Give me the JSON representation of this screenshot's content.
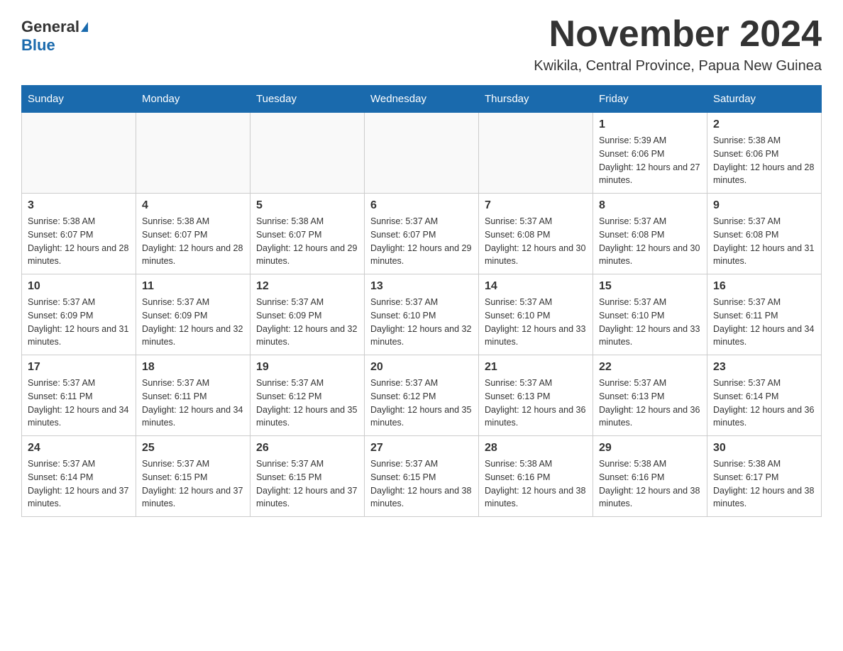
{
  "logo": {
    "general": "General",
    "blue": "Blue"
  },
  "header": {
    "month": "November 2024",
    "location": "Kwikila, Central Province, Papua New Guinea"
  },
  "days_of_week": [
    "Sunday",
    "Monday",
    "Tuesday",
    "Wednesday",
    "Thursday",
    "Friday",
    "Saturday"
  ],
  "weeks": [
    [
      {
        "day": "",
        "sunrise": "",
        "sunset": "",
        "daylight": ""
      },
      {
        "day": "",
        "sunrise": "",
        "sunset": "",
        "daylight": ""
      },
      {
        "day": "",
        "sunrise": "",
        "sunset": "",
        "daylight": ""
      },
      {
        "day": "",
        "sunrise": "",
        "sunset": "",
        "daylight": ""
      },
      {
        "day": "",
        "sunrise": "",
        "sunset": "",
        "daylight": ""
      },
      {
        "day": "1",
        "sunrise": "Sunrise: 5:39 AM",
        "sunset": "Sunset: 6:06 PM",
        "daylight": "Daylight: 12 hours and 27 minutes."
      },
      {
        "day": "2",
        "sunrise": "Sunrise: 5:38 AM",
        "sunset": "Sunset: 6:06 PM",
        "daylight": "Daylight: 12 hours and 28 minutes."
      }
    ],
    [
      {
        "day": "3",
        "sunrise": "Sunrise: 5:38 AM",
        "sunset": "Sunset: 6:07 PM",
        "daylight": "Daylight: 12 hours and 28 minutes."
      },
      {
        "day": "4",
        "sunrise": "Sunrise: 5:38 AM",
        "sunset": "Sunset: 6:07 PM",
        "daylight": "Daylight: 12 hours and 28 minutes."
      },
      {
        "day": "5",
        "sunrise": "Sunrise: 5:38 AM",
        "sunset": "Sunset: 6:07 PM",
        "daylight": "Daylight: 12 hours and 29 minutes."
      },
      {
        "day": "6",
        "sunrise": "Sunrise: 5:37 AM",
        "sunset": "Sunset: 6:07 PM",
        "daylight": "Daylight: 12 hours and 29 minutes."
      },
      {
        "day": "7",
        "sunrise": "Sunrise: 5:37 AM",
        "sunset": "Sunset: 6:08 PM",
        "daylight": "Daylight: 12 hours and 30 minutes."
      },
      {
        "day": "8",
        "sunrise": "Sunrise: 5:37 AM",
        "sunset": "Sunset: 6:08 PM",
        "daylight": "Daylight: 12 hours and 30 minutes."
      },
      {
        "day": "9",
        "sunrise": "Sunrise: 5:37 AM",
        "sunset": "Sunset: 6:08 PM",
        "daylight": "Daylight: 12 hours and 31 minutes."
      }
    ],
    [
      {
        "day": "10",
        "sunrise": "Sunrise: 5:37 AM",
        "sunset": "Sunset: 6:09 PM",
        "daylight": "Daylight: 12 hours and 31 minutes."
      },
      {
        "day": "11",
        "sunrise": "Sunrise: 5:37 AM",
        "sunset": "Sunset: 6:09 PM",
        "daylight": "Daylight: 12 hours and 32 minutes."
      },
      {
        "day": "12",
        "sunrise": "Sunrise: 5:37 AM",
        "sunset": "Sunset: 6:09 PM",
        "daylight": "Daylight: 12 hours and 32 minutes."
      },
      {
        "day": "13",
        "sunrise": "Sunrise: 5:37 AM",
        "sunset": "Sunset: 6:10 PM",
        "daylight": "Daylight: 12 hours and 32 minutes."
      },
      {
        "day": "14",
        "sunrise": "Sunrise: 5:37 AM",
        "sunset": "Sunset: 6:10 PM",
        "daylight": "Daylight: 12 hours and 33 minutes."
      },
      {
        "day": "15",
        "sunrise": "Sunrise: 5:37 AM",
        "sunset": "Sunset: 6:10 PM",
        "daylight": "Daylight: 12 hours and 33 minutes."
      },
      {
        "day": "16",
        "sunrise": "Sunrise: 5:37 AM",
        "sunset": "Sunset: 6:11 PM",
        "daylight": "Daylight: 12 hours and 34 minutes."
      }
    ],
    [
      {
        "day": "17",
        "sunrise": "Sunrise: 5:37 AM",
        "sunset": "Sunset: 6:11 PM",
        "daylight": "Daylight: 12 hours and 34 minutes."
      },
      {
        "day": "18",
        "sunrise": "Sunrise: 5:37 AM",
        "sunset": "Sunset: 6:11 PM",
        "daylight": "Daylight: 12 hours and 34 minutes."
      },
      {
        "day": "19",
        "sunrise": "Sunrise: 5:37 AM",
        "sunset": "Sunset: 6:12 PM",
        "daylight": "Daylight: 12 hours and 35 minutes."
      },
      {
        "day": "20",
        "sunrise": "Sunrise: 5:37 AM",
        "sunset": "Sunset: 6:12 PM",
        "daylight": "Daylight: 12 hours and 35 minutes."
      },
      {
        "day": "21",
        "sunrise": "Sunrise: 5:37 AM",
        "sunset": "Sunset: 6:13 PM",
        "daylight": "Daylight: 12 hours and 36 minutes."
      },
      {
        "day": "22",
        "sunrise": "Sunrise: 5:37 AM",
        "sunset": "Sunset: 6:13 PM",
        "daylight": "Daylight: 12 hours and 36 minutes."
      },
      {
        "day": "23",
        "sunrise": "Sunrise: 5:37 AM",
        "sunset": "Sunset: 6:14 PM",
        "daylight": "Daylight: 12 hours and 36 minutes."
      }
    ],
    [
      {
        "day": "24",
        "sunrise": "Sunrise: 5:37 AM",
        "sunset": "Sunset: 6:14 PM",
        "daylight": "Daylight: 12 hours and 37 minutes."
      },
      {
        "day": "25",
        "sunrise": "Sunrise: 5:37 AM",
        "sunset": "Sunset: 6:15 PM",
        "daylight": "Daylight: 12 hours and 37 minutes."
      },
      {
        "day": "26",
        "sunrise": "Sunrise: 5:37 AM",
        "sunset": "Sunset: 6:15 PM",
        "daylight": "Daylight: 12 hours and 37 minutes."
      },
      {
        "day": "27",
        "sunrise": "Sunrise: 5:37 AM",
        "sunset": "Sunset: 6:15 PM",
        "daylight": "Daylight: 12 hours and 38 minutes."
      },
      {
        "day": "28",
        "sunrise": "Sunrise: 5:38 AM",
        "sunset": "Sunset: 6:16 PM",
        "daylight": "Daylight: 12 hours and 38 minutes."
      },
      {
        "day": "29",
        "sunrise": "Sunrise: 5:38 AM",
        "sunset": "Sunset: 6:16 PM",
        "daylight": "Daylight: 12 hours and 38 minutes."
      },
      {
        "day": "30",
        "sunrise": "Sunrise: 5:38 AM",
        "sunset": "Sunset: 6:17 PM",
        "daylight": "Daylight: 12 hours and 38 minutes."
      }
    ]
  ]
}
